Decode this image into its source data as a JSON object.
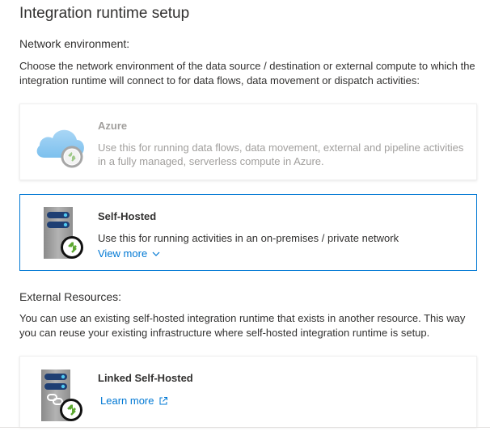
{
  "dialog": {
    "title": "Integration runtime setup"
  },
  "network": {
    "heading": "Network environment:",
    "description": "Choose the network environment of the data source / destination or external compute to which the integration runtime will connect to for data flows, data movement or dispatch activities:"
  },
  "options": [
    {
      "title": "Azure",
      "description": "Use this for running data flows, data movement, external and pipeline activities in a fully managed, serverless compute in Azure.",
      "icon": "cloud-runtime-icon",
      "state": "disabled"
    },
    {
      "title": "Self-Hosted",
      "description": "Use this for running activities in an on-premises / private network",
      "link": "View more",
      "icon": "server-runtime-icon",
      "state": "selected"
    }
  ],
  "external": {
    "heading": "External Resources:",
    "description": "You can use an existing self-hosted integration runtime that exists in another resource. This way you can reuse your existing infrastructure where self-hosted integration runtime is setup.",
    "card": {
      "title": "Linked Self-Hosted",
      "link": "Learn more",
      "icon": "linked-server-runtime-icon"
    }
  },
  "colors": {
    "accent": "#0078d4",
    "runtime_green": "#5ea832",
    "disabled_text": "#a19f9d"
  }
}
